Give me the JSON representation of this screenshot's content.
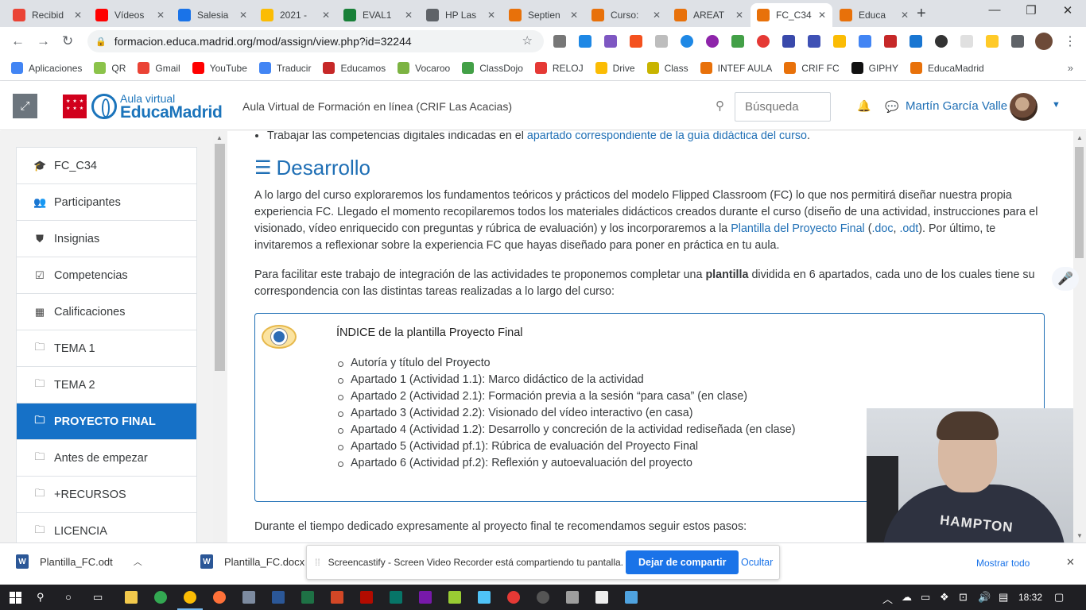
{
  "browser": {
    "tabs": [
      {
        "label": "Recibid",
        "favicon": "gmail-icon",
        "color": "#ea4335"
      },
      {
        "label": "Vídeos",
        "favicon": "youtube-icon",
        "color": "#ff0000"
      },
      {
        "label": "Salesia",
        "favicon": "calendar-icon",
        "color": "#1a73e8"
      },
      {
        "label": "2021 -",
        "favicon": "drive-icon",
        "color": "#fbbc04"
      },
      {
        "label": "EVAL1",
        "favicon": "classroom-icon",
        "color": "#188038"
      },
      {
        "label": "HP Las",
        "favicon": "globe-icon",
        "color": "#5f6368"
      },
      {
        "label": "Septien",
        "favicon": "moodle-icon",
        "color": "#e8710a"
      },
      {
        "label": "Curso:",
        "favicon": "moodle-icon",
        "color": "#e8710a"
      },
      {
        "label": "AREAT",
        "favicon": "moodle-icon",
        "color": "#e8710a"
      },
      {
        "label": "FC_C34",
        "favicon": "moodle-icon",
        "color": "#e8710a"
      },
      {
        "label": "Educa",
        "favicon": "moodle-icon",
        "color": "#e8710a"
      }
    ],
    "active_tab": 9,
    "url": "formacion.educa.madrid.org/mod/assign/view.php?id=32244",
    "bookmarks": [
      {
        "label": "Aplicaciones",
        "icon": "apps-grid-icon",
        "color": "#4285f4"
      },
      {
        "label": "QR",
        "icon": "qr-icon",
        "color": "#8bc34a"
      },
      {
        "label": "Gmail",
        "icon": "gmail-icon",
        "color": "#ea4335"
      },
      {
        "label": "YouTube",
        "icon": "youtube-icon",
        "color": "#ff0000"
      },
      {
        "label": "Traducir",
        "icon": "translate-icon",
        "color": "#4285f4"
      },
      {
        "label": "Educamos",
        "icon": "educamos-icon",
        "color": "#c62828"
      },
      {
        "label": "Vocaroo",
        "icon": "vocaroo-icon",
        "color": "#7cb342"
      },
      {
        "label": "ClassDojo",
        "icon": "classdojo-icon",
        "color": "#43a047"
      },
      {
        "label": "RELOJ",
        "icon": "clock-icon",
        "color": "#e53935"
      },
      {
        "label": "Drive",
        "icon": "drive-icon",
        "color": "#fbbc04"
      },
      {
        "label": "Class",
        "icon": "classroom-icon",
        "color": "#c8b400"
      },
      {
        "label": "INTEF AULA",
        "icon": "moodle-icon",
        "color": "#e8710a"
      },
      {
        "label": "CRIF FC",
        "icon": "moodle-icon",
        "color": "#e8710a"
      },
      {
        "label": "GIPHY",
        "icon": "giphy-icon",
        "color": "#111111"
      },
      {
        "label": "EducaMadrid",
        "icon": "moodle-icon",
        "color": "#e8710a"
      }
    ]
  },
  "header": {
    "logo_line1": "Aula virtual",
    "logo_line2": "EducaMadrid",
    "site_name": "Aula Virtual de Formación en línea (CRIF Las Acacias)",
    "search_placeholder": "Búsqueda",
    "user_name": "Martín García Valle"
  },
  "sidebar": {
    "items": [
      {
        "label": "FC_C34",
        "icon": "graduation-cap-icon",
        "glyph": "🎓"
      },
      {
        "label": "Participantes",
        "icon": "users-icon",
        "glyph": "👥"
      },
      {
        "label": "Insignias",
        "icon": "shield-icon",
        "glyph": "⛊"
      },
      {
        "label": "Competencias",
        "icon": "checkbox-icon",
        "glyph": "☑"
      },
      {
        "label": "Calificaciones",
        "icon": "table-icon",
        "glyph": "▦"
      },
      {
        "label": "TEMA 1",
        "icon": "folder-icon",
        "glyph": "🗀"
      },
      {
        "label": "TEMA 2",
        "icon": "folder-icon",
        "glyph": "🗀"
      },
      {
        "label": "PROYECTO FINAL",
        "icon": "folder-icon",
        "glyph": "🗀",
        "active": true
      },
      {
        "label": "Antes de empezar",
        "icon": "folder-icon",
        "glyph": "🗀"
      },
      {
        "label": "+RECURSOS",
        "icon": "folder-icon",
        "glyph": "🗀"
      },
      {
        "label": "LICENCIA",
        "icon": "folder-icon",
        "glyph": "🗀"
      }
    ]
  },
  "content": {
    "top_bullet_text": "Trabajar las competencias digitales indicadas en el ",
    "top_bullet_link": "apartado correspondiente de la guía didáctica del curso",
    "top_bullet_end": ".",
    "heading": "Desarrollo",
    "para1_a": "A lo largo del curso exploraremos los fundamentos teóricos y prácticos del modelo Flipped Classroom (FC) lo que nos permitirá diseñar nuestra propia experiencia FC. Llegado el momento recopilaremos todos los materiales didácticos creados durante el curso (diseño de una actividad, instrucciones para el visionado, vídeo enriquecido con preguntas y rúbrica de evaluación) y los incorporaremos a la ",
    "para1_link1": "Plantilla del Proyecto Final",
    "para1_b": " (",
    "para1_link2": ".doc",
    "para1_c": ", ",
    "para1_link3": ".odt",
    "para1_d": "). Por último, te invitaremos a reflexionar sobre la experiencia FC que hayas diseñado para poner en práctica en tu aula.",
    "para2_a": "Para facilitar este trabajo de integración de las actividades te proponemos completar una ",
    "para2_bold": "plantilla",
    "para2_b": " dividida en 6 apartados, cada uno de los cuales tiene su correspondencia con las distintas tareas realizadas a lo largo del curso:",
    "index_title": "ÍNDICE de la plantilla Proyecto Final",
    "index_items": [
      "Autoría y título del Proyecto",
      "Apartado 1 (Actividad 1.1): Marco didáctico de la actividad",
      "Apartado 2 (Actividad 2.1): Formación previa a la sesión “para casa”  (en clase)",
      "Apartado 3 (Actividad 2.2): Visionado del vídeo interactivo (en casa)",
      "Apartado 4 (Actividad 1.2): Desarrollo y concreción de la actividad rediseñada (en clase)",
      "Apartado 5 (Actividad pf.1): Rúbrica de evaluación del Proyecto Final",
      "Apartado 6 (Actividad pf.2): Reflexión y autoevaluación del proyecto"
    ],
    "para3": "Durante el tiempo dedicado expresamente al proyecto final te recomendamos seguir estos pasos:"
  },
  "webcam": {
    "shirt_text": "HAMPTON"
  },
  "downloads": {
    "items": [
      {
        "label": "Plantilla_FC.odt"
      },
      {
        "label": "Plantilla_FC.docx"
      }
    ],
    "show_all": "Mostrar todo"
  },
  "sharebar": {
    "message": "Screencastify - Screen Video Recorder está compartiendo tu pantalla.",
    "stop_label": "Dejar de compartir",
    "hide_label": "Ocultar"
  },
  "taskbar": {
    "time": "18:32"
  },
  "colors": {
    "accent": "#1671c7",
    "link": "#1f6fb5"
  }
}
